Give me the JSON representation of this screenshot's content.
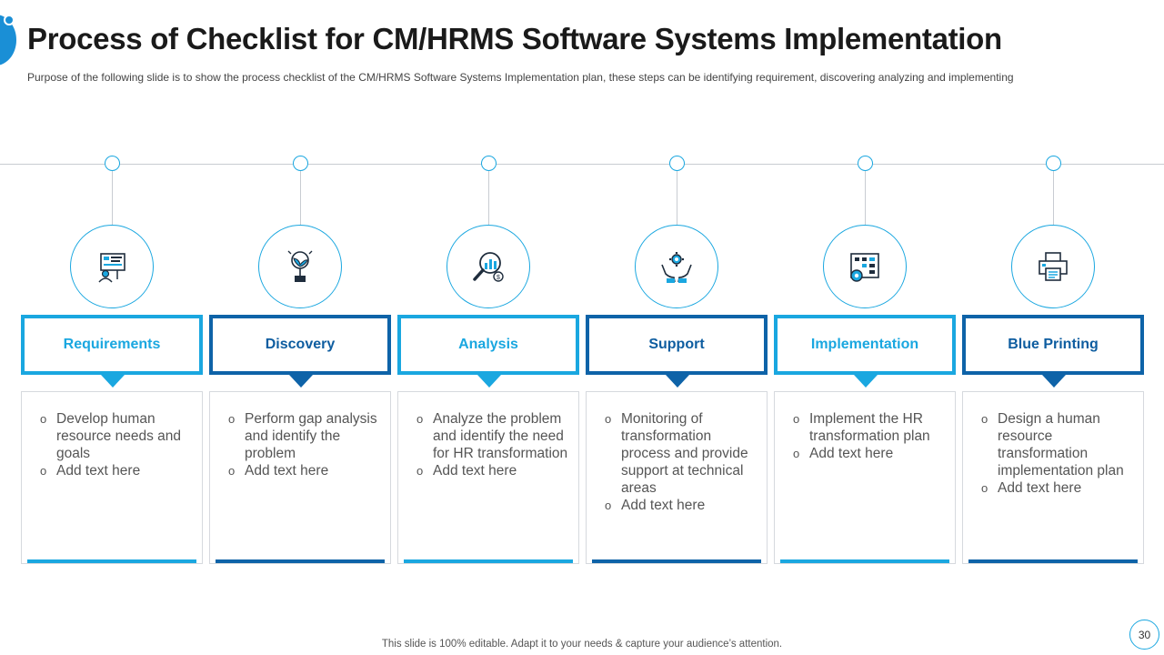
{
  "slide": {
    "title": "Process of Checklist for CM/HRMS Software Systems Implementation",
    "subtitle": "Purpose of the following slide is to show the process checklist of the CM/HRMS Software Systems Implementation plan, these steps can be identifying requirement, discovering analyzing and implementing",
    "footer": "This slide is 100% editable. Adapt it to your needs & capture your audience’s attention.",
    "page_number": "30"
  },
  "colors": {
    "light_blue": "#1aa7e0",
    "dark_blue": "#0e63a8"
  },
  "steps": [
    {
      "title": "Requirements",
      "icon": "hr-presentation-icon",
      "bullets": [
        "Develop human resource needs and goals",
        "Add text here"
      ]
    },
    {
      "title": "Discovery",
      "icon": "idea-plant-icon",
      "bullets": [
        "Perform gap analysis and identify the problem",
        "Add text here"
      ]
    },
    {
      "title": "Analysis",
      "icon": "magnifier-chart-icon",
      "bullets": [
        "Analyze the problem and identify the need for HR transformation",
        "Add text here"
      ]
    },
    {
      "title": "Support",
      "icon": "hands-gear-icon",
      "bullets": [
        "Monitoring of transformation process and provide support at technical areas",
        "Add text here"
      ]
    },
    {
      "title": "Implementation",
      "icon": "blueprint-gear-icon",
      "bullets": [
        "Implement the HR transformation plan",
        "Add text here"
      ]
    },
    {
      "title": "Blue Printing",
      "icon": "printer-icon",
      "bullets": [
        "Design a human resource transformation implementation plan",
        "Add text here"
      ]
    }
  ]
}
